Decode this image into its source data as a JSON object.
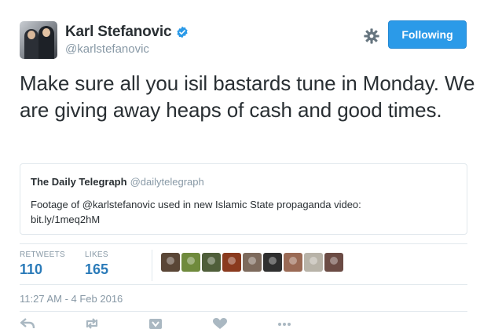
{
  "user": {
    "name": "Karl Stefanovic",
    "handle": "@karlstefanovic",
    "follow_label": "Following"
  },
  "tweet": {
    "text": "Make sure all you isil bastards tune in Monday. We are giving away heaps of cash and good times."
  },
  "quote": {
    "name": "The Daily Telegraph",
    "handle": "@dailytelegraph",
    "text_line1": "Footage of @karlstefanovic used in new Islamic State propaganda video:",
    "text_line2": "bit.ly/1meq2hM"
  },
  "stats": {
    "retweets_label": "RETWEETS",
    "retweets_value": "110",
    "likes_label": "LIKES",
    "likes_value": "165"
  },
  "likers_colors": [
    "#5a4636",
    "#6f8a3c",
    "#4f5e3a",
    "#8a3a1e",
    "#7d6a5c",
    "#2f2f2f",
    "#9a6a55",
    "#b8b3a8",
    "#6b4b44"
  ],
  "timestamp": "11:27 AM - 4 Feb 2016",
  "colors": {
    "accent": "#2b9ae8",
    "link": "#2b7bb9",
    "muted": "#8899a6",
    "text": "#292f33"
  }
}
